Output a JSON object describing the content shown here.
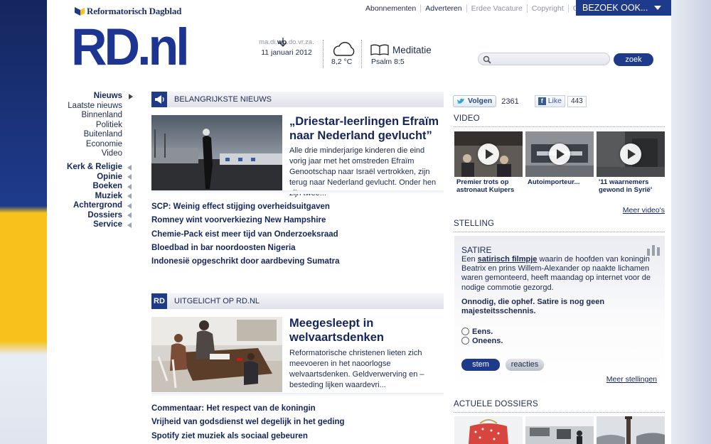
{
  "header": {
    "brand_small": "Reformatorisch Dagblad",
    "brand_big": "RD.nl",
    "top_links": [
      "Abonnementen",
      "Adverteren",
      "Erdee Vacature",
      "Copyright",
      "Contact"
    ],
    "bezoek_label": "BEZOEK OOK...",
    "days": {
      "pre": "ma.di.",
      "current": "wo",
      "post": ".do.vr.za."
    },
    "date": "11 januari 2012",
    "temperature": "8,2 °C",
    "meditation_title": "Meditatie",
    "meditation_ref": "Psalm 8:5",
    "search_placeholder": "",
    "search_button": "zoek"
  },
  "nav": {
    "group1": [
      "Nieuws",
      "Laatste nieuws",
      "Binnenland",
      "Politiek",
      "Buitenland",
      "Economie",
      "Video"
    ],
    "group2": [
      "Kerk & Religie",
      "Opinie",
      "Boeken",
      "Muziek",
      "Achtergrond",
      "Dossiers",
      "Service"
    ]
  },
  "news": {
    "section_title": "BELANGRIJKSTE NIEUWS",
    "feature_title": "„Driestar-leerlingen Efraïm naar Nederland gevlucht”",
    "feature_text": "Alle drie minderjarige kinderen die eind vorig jaar met het omstreden Efraïm Genootschap naar Israël vertrokken, zijn terug naar Nederland gevlucht. Onder hen zijn twee...",
    "headlines": [
      "SCP: Weinig effect stijging overheidsuitgaven",
      "Romney wint voorverkiezing New Hampshire",
      "Chemie-Pack eist meer tijd van Onderzoeksraad",
      "Bloedbad in bar noordoosten Nigeria",
      "Indonesië opgeschrikt door aardbeving Sumatra"
    ]
  },
  "highlight": {
    "badge": "RD",
    "section_title": "UITGELICHT OP RD.NL",
    "feature_title": "Meegesleept in welvaartsdenken",
    "feature_text": "Reformatorische christenen lieten zich meevoeren in het naoorlogse welvaartsdenken. Geldverwerving en –besteding lijken waardevri...",
    "headlines": [
      "Commentaar: Het respect van de koningin",
      "Vrijheid van godsdienst wel degelijk in het geding",
      "Spotify ziet muziek als sociaal gebeuren"
    ]
  },
  "social": {
    "twitter_label": "Volgen",
    "twitter_count": "2361",
    "facebook_label": "Like",
    "facebook_count": "443"
  },
  "video": {
    "heading": "VIDEO",
    "items": [
      {
        "caption": "Premier trots op astronaut Kuipers"
      },
      {
        "caption": "Autoimporteur..."
      },
      {
        "caption": "'11 waarnemers gewond in Syrië'"
      }
    ],
    "more": "Meer video's"
  },
  "poll": {
    "heading": "STELLING",
    "title": "SATIRE",
    "text_link": "satirisch filmpje",
    "text_before": "Een",
    "text_after": "waarin de hoofden van koningin Beatrix en prins Willem-Alexander op naakte lichamen waren gemonteerd, heeft maandag op internet voor de nodige commotie gezorgd.",
    "statement": "Onnodig, die ophef. Satire is nog geen majesteitsschennis.",
    "options": [
      "Eens.",
      "Oneens."
    ],
    "vote_button": "stem",
    "reactions_button": "reacties",
    "more": "Meer stellingen"
  },
  "dossiers": {
    "heading": "ACTUELE DOSSIERS"
  },
  "colors": {
    "brand_blue": "#1e3a8a",
    "accent_yellow": "#f7c21b"
  }
}
